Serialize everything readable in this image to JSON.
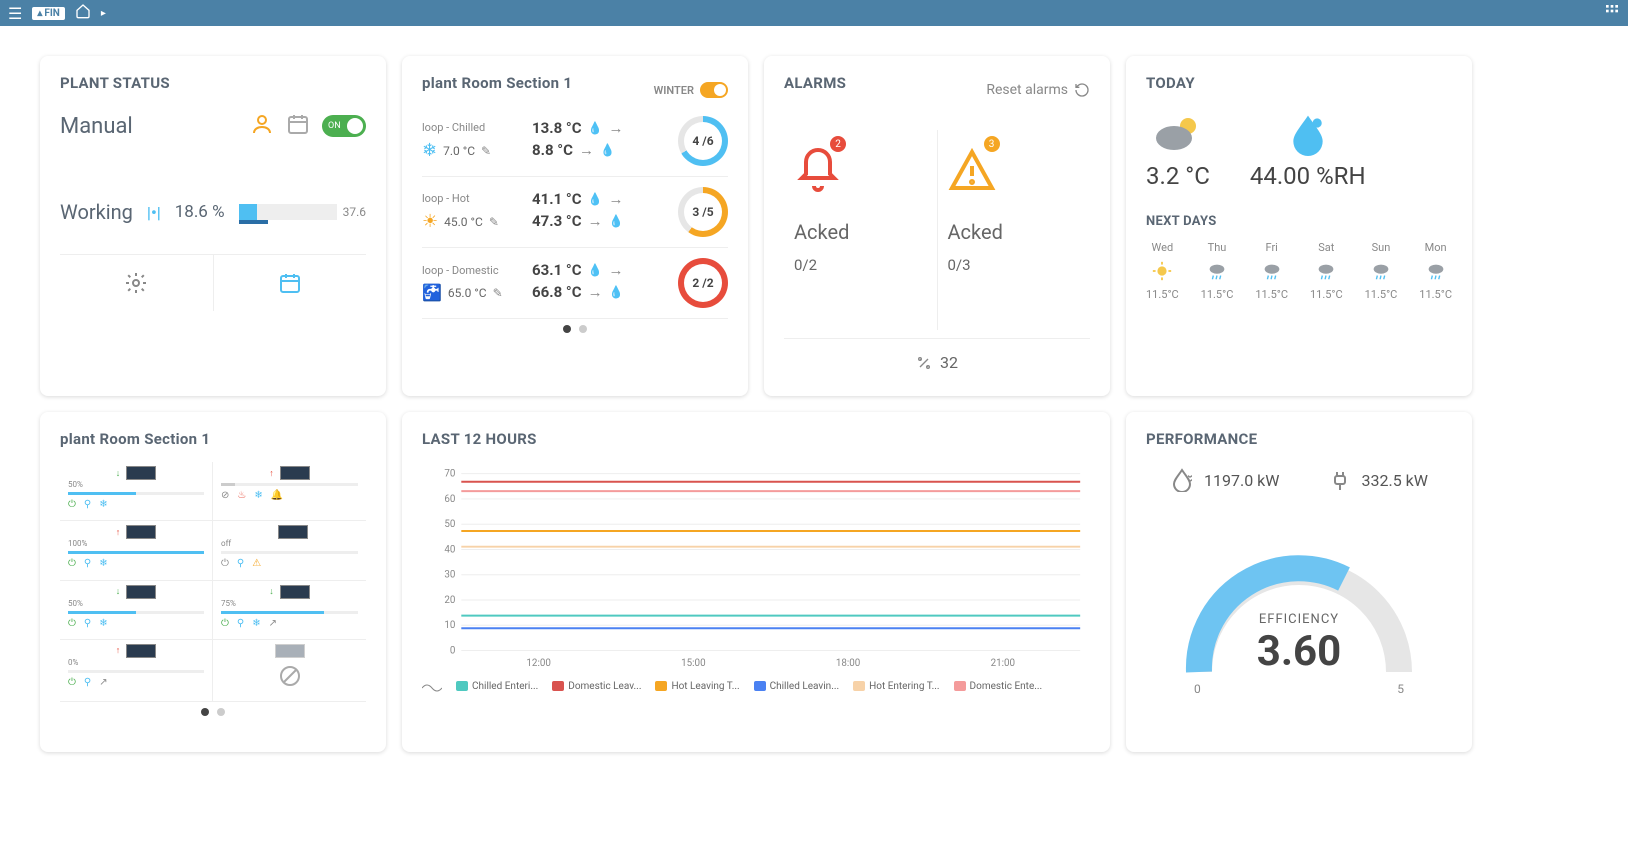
{
  "topbar": {
    "brand": "FIN",
    "home_icon": "home",
    "grid_icon": "grid"
  },
  "plant_status": {
    "title": "PLANT STATUS",
    "mode_label": "Manual",
    "toggle_label": "ON",
    "working_label": "Working",
    "working_pct": "18.6 %",
    "bar_end": "37.6"
  },
  "plant_room1": {
    "title": "plant Room Section 1",
    "season_label": "WINTER",
    "loops": [
      {
        "name": "loop - Chilled",
        "setpoint": "7.0 °C",
        "t1": "13.8 °C",
        "t2": "8.8 °C",
        "ratio": "4 /6",
        "icon": "snow",
        "ring": "ring-chilled"
      },
      {
        "name": "loop - Hot",
        "setpoint": "45.0 °C",
        "t1": "41.1 °C",
        "t2": "47.3 °C",
        "ratio": "3 /5",
        "icon": "sun",
        "ring": "ring-hot"
      },
      {
        "name": "loop - Domestic",
        "setpoint": "65.0 °C",
        "t1": "63.1 °C",
        "t2": "66.8 °C",
        "ratio": "2 /2",
        "icon": "tap",
        "ring": "ring-dom"
      }
    ]
  },
  "alarms": {
    "title": "ALARMS",
    "reset_label": "Reset alarms",
    "cols": [
      {
        "badge": "2",
        "badge_color": "#e74c3c",
        "acked_label": "Acked",
        "count": "0/2",
        "icon": "bell"
      },
      {
        "badge": "3",
        "badge_color": "#f5a623",
        "acked_label": "Acked",
        "count": "0/3",
        "icon": "warn"
      }
    ],
    "tools_count": "32"
  },
  "today": {
    "title": "TODAY",
    "temp": "3.2 °C",
    "rh": "44.00 %RH",
    "next_label": "NEXT DAYS",
    "days": [
      {
        "d": "Wed",
        "t": "11.5°C",
        "icon": "sun"
      },
      {
        "d": "Thu",
        "t": "11.5°C",
        "icon": "rain"
      },
      {
        "d": "Fri",
        "t": "11.5°C",
        "icon": "rain"
      },
      {
        "d": "Sat",
        "t": "11.5°C",
        "icon": "rain"
      },
      {
        "d": "Sun",
        "t": "11.5°C",
        "icon": "rain"
      },
      {
        "d": "Mon",
        "t": "11.5°C",
        "icon": "rain"
      }
    ]
  },
  "plant_room2": {
    "title": "plant Room Section 1",
    "units": [
      {
        "pct": "50%",
        "fill": 50,
        "color": "#4fbff2",
        "arrow": "down"
      },
      {
        "pct": "",
        "fill": 10,
        "color": "#ccc",
        "arrow": "up"
      },
      {
        "pct": "100%",
        "fill": 100,
        "color": "#4fbff2",
        "arrow": "up"
      },
      {
        "pct": "off",
        "fill": 0,
        "color": "#ccc",
        "arrow": ""
      },
      {
        "pct": "50%",
        "fill": 50,
        "color": "#4fbff2",
        "arrow": "down"
      },
      {
        "pct": "75%",
        "fill": 75,
        "color": "#4fbff2",
        "arrow": "down"
      },
      {
        "pct": "0%",
        "fill": 0,
        "color": "#ccc",
        "arrow": "up"
      },
      {
        "pct": "",
        "fill": 0,
        "color": "#ccc",
        "arrow": "",
        "disabled": true
      }
    ]
  },
  "chart": {
    "title": "LAST 12 HOURS"
  },
  "chart_data": {
    "type": "line",
    "x": [
      "12:00",
      "15:00",
      "18:00",
      "21:00"
    ],
    "ylim": [
      0,
      70
    ],
    "yticks": [
      0.0,
      10,
      20,
      30,
      40,
      50,
      60,
      70
    ],
    "series": [
      {
        "name": "Chilled Enteri...",
        "color": "#4fc9c0",
        "value": 13.8
      },
      {
        "name": "Domestic Leav...",
        "color": "#d9534f",
        "value": 66.8
      },
      {
        "name": "Hot Leaving T...",
        "color": "#f5a623",
        "value": 47.3
      },
      {
        "name": "Chilled Leavin...",
        "color": "#4b81f2",
        "value": 8.8
      },
      {
        "name": "Hot Entering T...",
        "color": "#f7d2a8",
        "value": 41.1
      },
      {
        "name": "Domestic Ente...",
        "color": "#f49b9b",
        "value": 63.1
      }
    ]
  },
  "performance": {
    "title": "PERFORMANCE",
    "kw1": "1197.0 kW",
    "kw2": "332.5 kW",
    "eff_label": "EFFICIENCY",
    "eff_val": "3.60",
    "min": "0",
    "max": "5"
  }
}
